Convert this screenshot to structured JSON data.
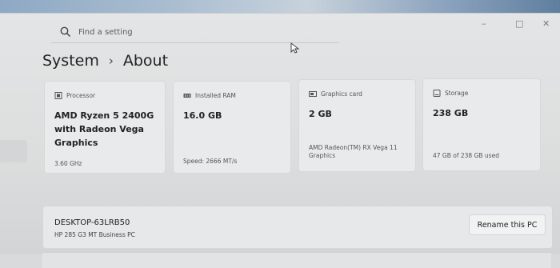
{
  "search": {
    "placeholder": "Find a setting"
  },
  "breadcrumb": {
    "parent": "System",
    "separator": "›",
    "current": "About"
  },
  "window_controls": {
    "minimize": "–",
    "maximize": "□",
    "close": "✕"
  },
  "specs": [
    {
      "label": "Processor",
      "icon": "processor-icon",
      "value": [
        "AMD Ryzen 5 2400G",
        "with Radeon Vega",
        "Graphics"
      ],
      "footer": [
        "3.60 GHz"
      ]
    },
    {
      "label": "Installed RAM",
      "icon": "ram-icon",
      "value": [
        "16.0 GB"
      ],
      "footer": [
        "Speed: 2666 MT/s"
      ]
    },
    {
      "label": "Graphics card",
      "icon": "graphics-card-icon",
      "value": [
        "2 GB"
      ],
      "footer": [
        "AMD Radeon(TM) RX Vega 11",
        "Graphics"
      ]
    },
    {
      "label": "Storage",
      "icon": "storage-icon",
      "value": [
        "238 GB"
      ],
      "footer": [
        "47 GB of 238 GB used"
      ]
    }
  ],
  "device": {
    "name": "DESKTOP-63LRB50",
    "model": "HP 285 G3 MT Business PC",
    "rename_label": "Rename this PC"
  },
  "colors": {
    "background": "#dcdddd",
    "card": "#e9eaeb",
    "text": "#222222"
  }
}
